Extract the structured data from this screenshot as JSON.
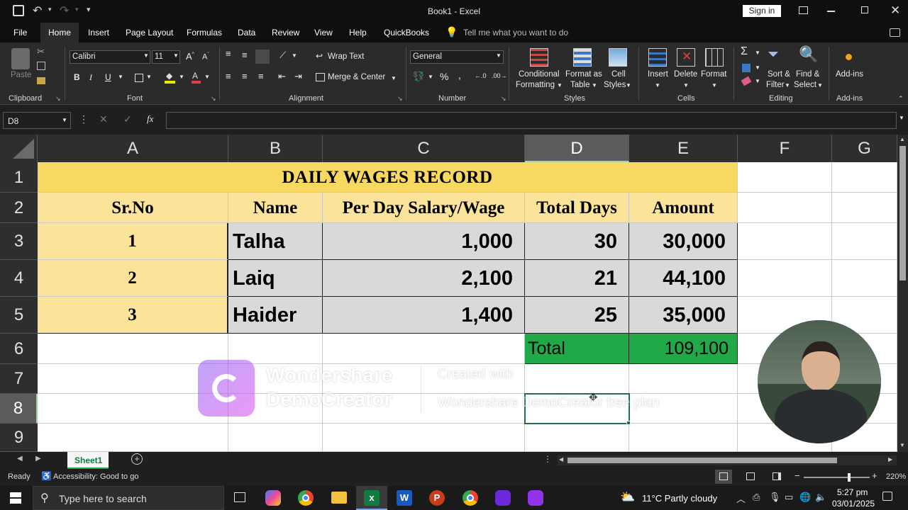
{
  "titlebar": {
    "title": "Book1  -  Excel",
    "sign_in": "Sign in"
  },
  "menu": [
    "File",
    "Home",
    "Insert",
    "Page Layout",
    "Formulas",
    "Data",
    "Review",
    "View",
    "Help",
    "QuickBooks"
  ],
  "tell_me": "Tell me what you want to do",
  "ribbon": {
    "paste": "Paste",
    "font_name": "Calibri",
    "font_size": "11",
    "wrap_text": "Wrap Text",
    "merge_center": "Merge & Center",
    "number_format": "General",
    "conditional": "Conditional",
    "formatting": "Formatting",
    "format_as": "Format as",
    "table": "Table",
    "cell": "Cell",
    "styles_lbl": "Styles",
    "insert": "Insert",
    "delete": "Delete",
    "format": "Format",
    "sort": "Sort &",
    "filter": "Filter",
    "find": "Find &",
    "select": "Select",
    "addins": "Add-ins",
    "groups": {
      "clipboard": "Clipboard",
      "font": "Font",
      "alignment": "Alignment",
      "number": "Number",
      "styles": "Styles",
      "cells": "Cells",
      "editing": "Editing",
      "addins": "Add-ins"
    }
  },
  "formula": {
    "namebox": "D8",
    "fx": "fx",
    "content": ""
  },
  "columns": [
    "A",
    "B",
    "C",
    "D",
    "E",
    "F",
    "G"
  ],
  "rows": [
    "1",
    "2",
    "3",
    "4",
    "5",
    "6",
    "7",
    "8",
    "9"
  ],
  "sheet": {
    "title": "DAILY WAGES RECORD",
    "headers": [
      "Sr.No",
      "Name",
      "Per Day Salary/Wage",
      "Total Days",
      "Amount"
    ],
    "data": [
      [
        "1",
        "Talha",
        "1,000",
        "30",
        "30,000"
      ],
      [
        "2",
        "Laiq",
        "2,100",
        "21",
        "44,100"
      ],
      [
        "3",
        "Haider",
        "1,400",
        "25",
        "35,000"
      ]
    ],
    "total_label": "Total",
    "total_value": "109,100"
  },
  "watermark": {
    "brand_line1": "Wondershare",
    "brand_line2": "DemoCreator",
    "note_line1": "Created with",
    "note_line2": "Wondershare DemoCreator free plan"
  },
  "sheet_tab": "Sheet1",
  "status": {
    "ready": "Ready",
    "accessibility": "Accessibility: Good to go",
    "zoom": "220%"
  },
  "taskbar": {
    "search": "Type here to search",
    "weather": "11°C  Partly cloudy",
    "time": "5:27 pm",
    "date": "03/01/2025"
  },
  "colors": {
    "title_fill": "#f7d860",
    "header_fill": "#fbe49a",
    "data_fill": "#d9d9d9",
    "total_fill": "#21a849",
    "excel_green": "#107c41"
  }
}
